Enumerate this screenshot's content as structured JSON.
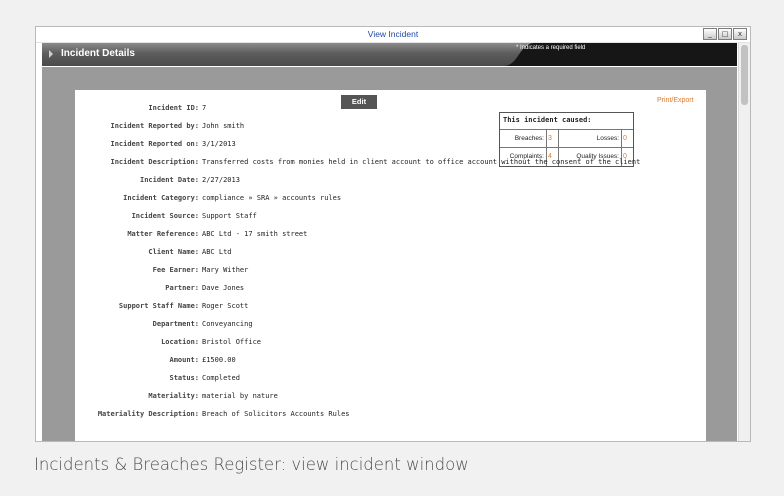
{
  "window": {
    "title": "View Incident",
    "buttons": [
      "_",
      "□",
      "x"
    ]
  },
  "section": {
    "title": "Incident Details",
    "required_note": "* Indicates a required field"
  },
  "actions": {
    "edit_label": "Edit",
    "print_label": "Print/Export"
  },
  "caused": {
    "title": "This incident caused:",
    "breaches_label": "Breaches:",
    "breaches_value": "3",
    "losses_label": "Losses:",
    "losses_value": "0",
    "complaints_label": "Complaints:",
    "complaints_value": "4",
    "quality_label": "Quality Issues:",
    "quality_value": "0"
  },
  "fields": [
    {
      "label": "Incident ID:",
      "value": "7"
    },
    {
      "label": "Incident Reported by:",
      "value": "John smith"
    },
    {
      "label": "Incident Reported on:",
      "value": "3/1/2013"
    },
    {
      "label": "Incident Description:",
      "value": "Transferred costs from monies held in client account to office account without the consent of the client"
    },
    {
      "label": "Incident Date:",
      "value": "2/27/2013"
    },
    {
      "label": "Incident Category:",
      "value": "compliance » SRA » accounts rules"
    },
    {
      "label": "Incident Source:",
      "value": "Support Staff"
    },
    {
      "label": "Matter Reference:",
      "value": "ABC Ltd - 17 smith street"
    },
    {
      "label": "Client Name:",
      "value": "ABC Ltd"
    },
    {
      "label": "Fee Earner:",
      "value": "Mary Wither"
    },
    {
      "label": "Partner:",
      "value": "Dave Jones"
    },
    {
      "label": "Support Staff Name:",
      "value": "Roger Scott"
    },
    {
      "label": "Department:",
      "value": "Conveyancing"
    },
    {
      "label": "Location:",
      "value": "Bristol Office"
    },
    {
      "label": "Amount:",
      "value": "£1500.00"
    },
    {
      "label": "Status:",
      "value": "Completed"
    },
    {
      "label": "Materiality:",
      "value": "material by nature"
    },
    {
      "label": "Materiality Description:",
      "value": "Breach of Solicitors Accounts Rules"
    }
  ],
  "caption": "Incidents & Breaches Register: view incident window",
  "colors": {
    "accent": "#e07a2e",
    "link": "#1f4aa8",
    "header_dark": "#1a1a1a"
  }
}
